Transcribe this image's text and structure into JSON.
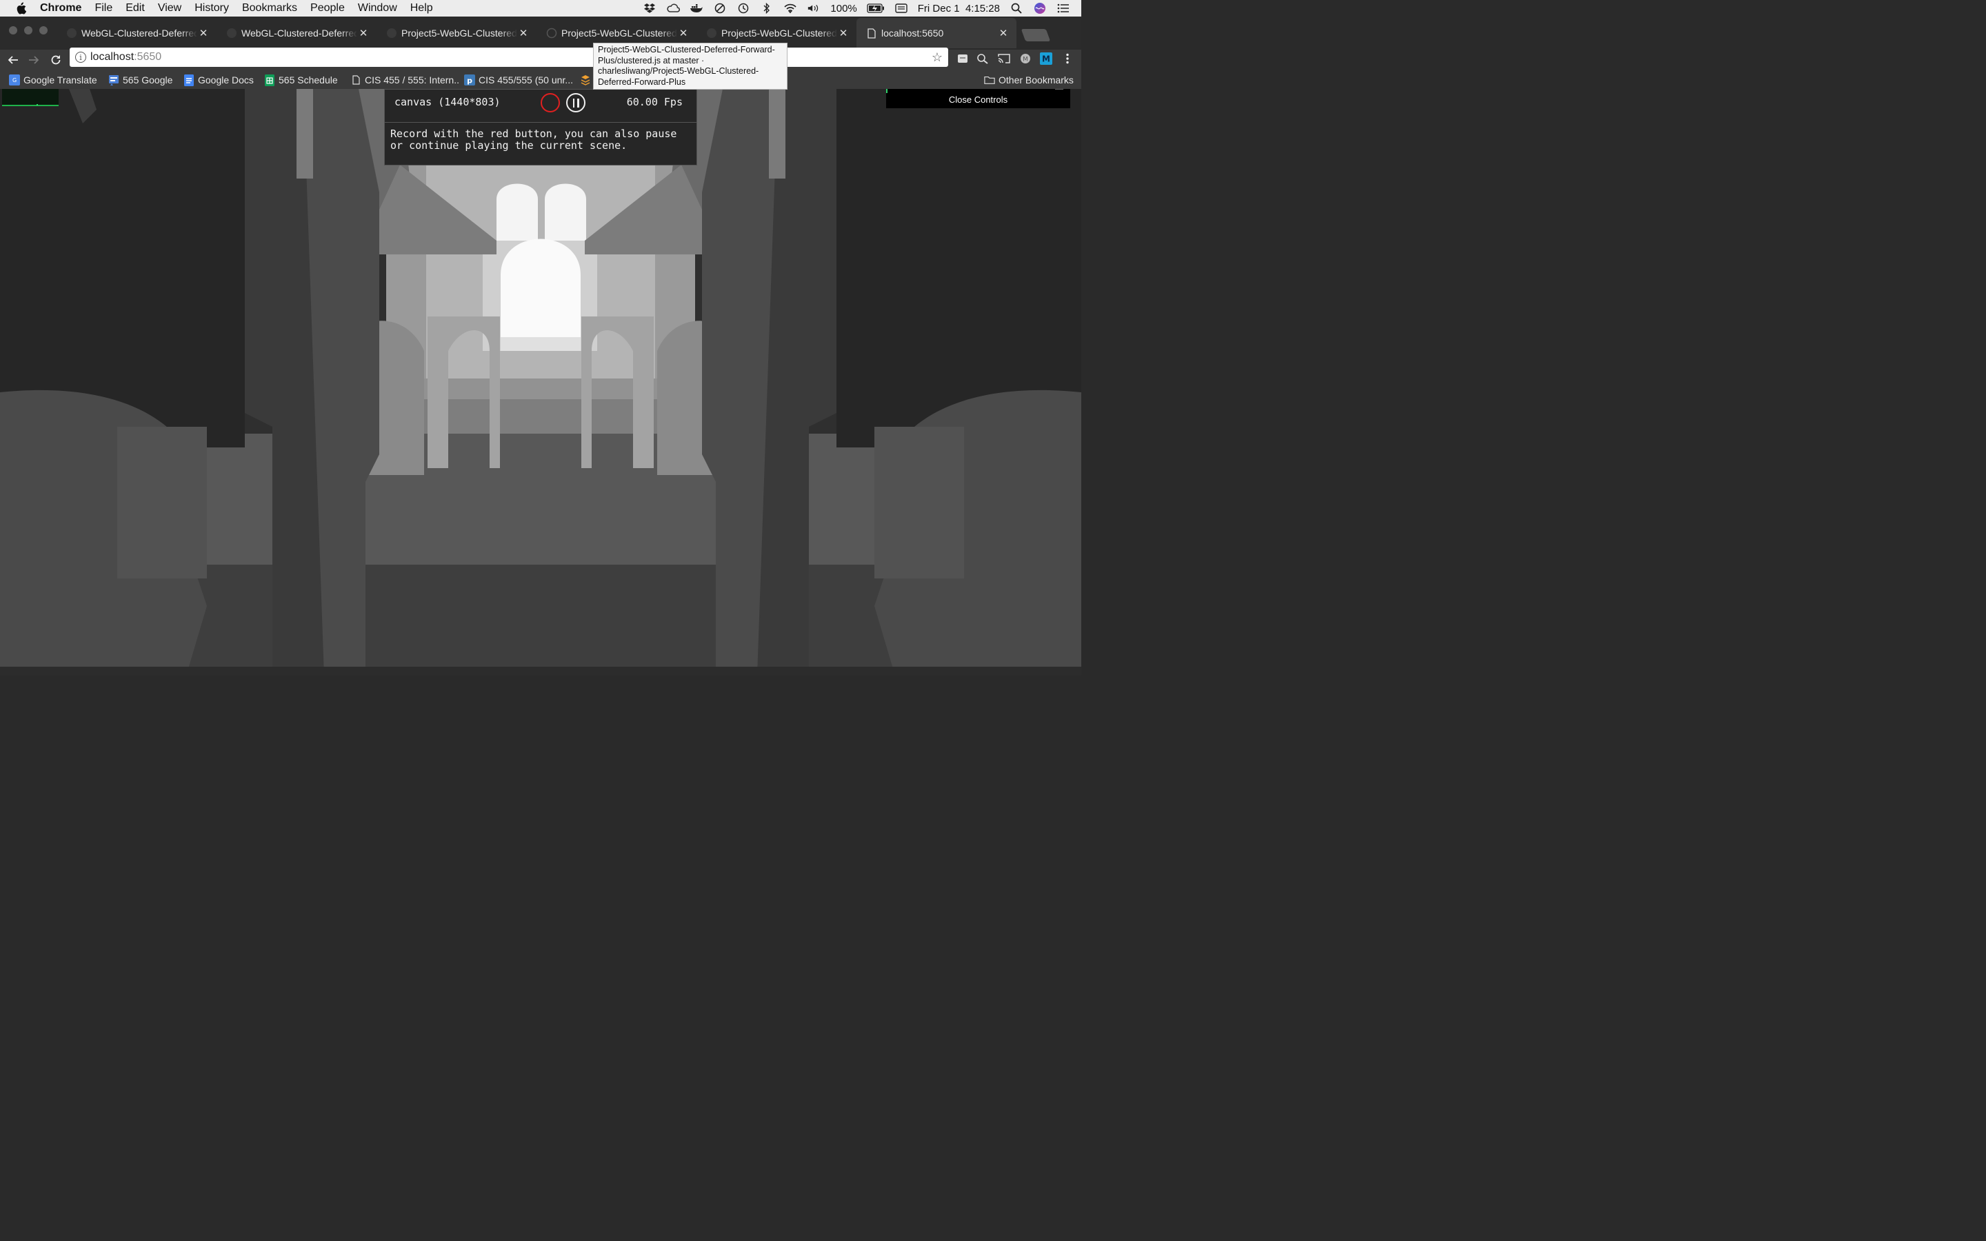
{
  "menubar": {
    "app_name": "Chrome",
    "items": [
      "File",
      "Edit",
      "View",
      "History",
      "Bookmarks",
      "People",
      "Window",
      "Help"
    ],
    "battery": "100%",
    "datetime": "Fri Dec 1  4:15:28"
  },
  "tabs": [
    {
      "title": "WebGL-Clustered-Deferred",
      "active": false
    },
    {
      "title": "WebGL-Clustered-Deferred",
      "active": false
    },
    {
      "title": "Project5-WebGL-Clustered-",
      "active": false
    },
    {
      "title": "Project5-WebGL-Clustered-",
      "active": false
    },
    {
      "title": "Project5-WebGL-Clustered-",
      "active": false
    },
    {
      "title": "localhost:5650",
      "active": true
    }
  ],
  "tooltip": {
    "text": "Project5-WebGL-Clustered-Deferred-Forward-Plus/clustered.js at master · charlesliwang/Project5-WebGL-Clustered-Deferred-Forward-Plus"
  },
  "omnibox": {
    "host": "localhost",
    "port": ":5650"
  },
  "bookmarks": [
    {
      "label": "Google Translate",
      "icon": "google-translate-icon",
      "color": "#4a86e8"
    },
    {
      "label": "565 Google",
      "icon": "sites-icon",
      "color": "#4a7fd6"
    },
    {
      "label": "Google Docs",
      "icon": "docs-icon",
      "color": "#4285f4"
    },
    {
      "label": "565 Schedule",
      "icon": "sheets-icon",
      "color": "#0f9d58"
    },
    {
      "label": "CIS 455 / 555: Intern..",
      "icon": "page-icon",
      "color": "#dddddd"
    },
    {
      "label": "CIS 455/555 (50 unr...",
      "icon": "piazza-icon",
      "color": "#3e7ab8"
    },
    {
      "label": "",
      "icon": "stack-icon",
      "color": "#f0a030"
    }
  ],
  "other_bookmarks": "Other Bookmarks",
  "panel": {
    "canvas_label": "canvas (1440*803)",
    "fps": "60.00 Fps",
    "help": "Record with the red button, you can also pause or continue playing the current scene."
  },
  "gui": {
    "close_label": "Close Controls"
  }
}
